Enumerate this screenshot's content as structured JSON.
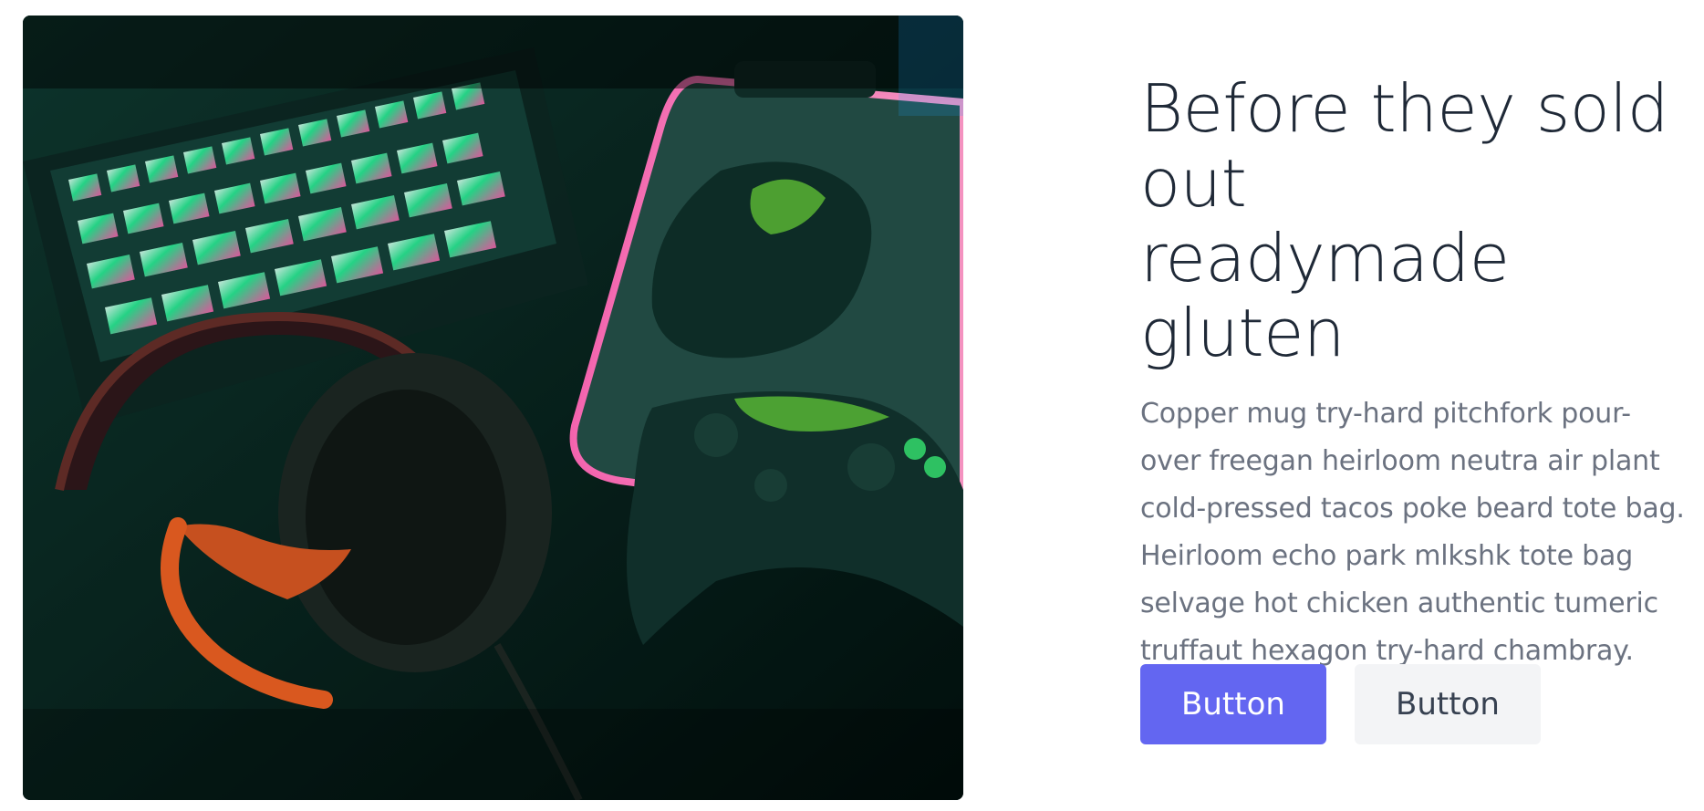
{
  "hero": {
    "title": "Before they sold out\nreadymade gluten",
    "description": "Copper mug try-hard pitchfork pour-over freegan heirloom neutra air plant cold-pressed tacos poke beard tote bag. Heirloom echo park mlkshk tote bag selvage hot chicken authentic tumeric truffaut hexagon try-hard chambray.",
    "primary_button_label": "Button",
    "secondary_button_label": "Button"
  },
  "image": {
    "subject": "gaming setup with RGB keyboard, mouse, headset and controller"
  },
  "colors": {
    "primary": "#6366f1",
    "secondary_bg": "#f3f4f6",
    "title_text": "#1f2937",
    "body_text": "#6b7280"
  }
}
